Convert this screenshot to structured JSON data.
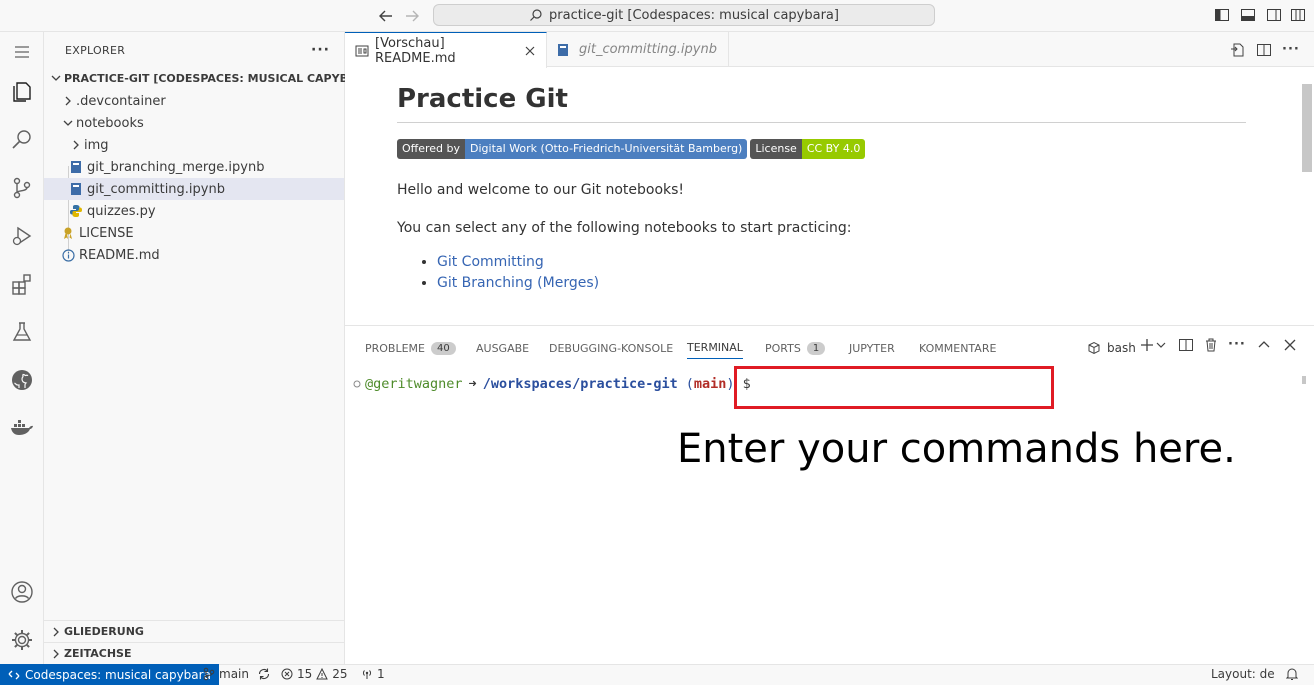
{
  "titlebar": {
    "search_text": "practice-git [Codespaces: musical capybara]"
  },
  "activity": {
    "items": [
      "explorer-icon",
      "search-icon",
      "source-control-icon",
      "run-debug-icon",
      "extensions-icon",
      "testing-icon",
      "github-icon",
      "docker-icon"
    ],
    "bottom": [
      "account-icon",
      "settings-gear-icon"
    ]
  },
  "sidebar": {
    "title": "EXPLORER",
    "root": "PRACTICE-GIT [CODESPACES: MUSICAL CAPYBARA]",
    "items": [
      {
        "label": ".devcontainer"
      },
      {
        "label": "notebooks"
      },
      {
        "label": "img"
      },
      {
        "label": "git_branching_merge.ipynb"
      },
      {
        "label": "git_committing.ipynb"
      },
      {
        "label": "quizzes.py"
      },
      {
        "label": "LICENSE"
      },
      {
        "label": "README.md"
      }
    ],
    "sections": [
      "GLIEDERUNG",
      "ZEITACHSE"
    ]
  },
  "tabs": [
    {
      "label": "[Vorschau] README.md",
      "active": true
    },
    {
      "label": "git_committing.ipynb",
      "active": false
    }
  ],
  "preview": {
    "title": "Practice Git",
    "badges": [
      {
        "left": "Offered by",
        "right": "Digital Work (Otto-Friedrich-Universität Bamberg)",
        "color": "#4c7fc0"
      },
      {
        "left": "License",
        "right": "CC BY 4.0",
        "color": "#97ca00"
      }
    ],
    "para1": "Hello and welcome to our Git notebooks!",
    "para2": "You can select any of the following notebooks to start practicing:",
    "links": [
      "Git Committing",
      "Git Branching (Merges)"
    ]
  },
  "panel": {
    "tabs": [
      {
        "label": "PROBLEME",
        "count": "40"
      },
      {
        "label": "AUSGABE"
      },
      {
        "label": "DEBUGGING-KONSOLE"
      },
      {
        "label": "TERMINAL",
        "active": true
      },
      {
        "label": "PORTS",
        "count": "1"
      },
      {
        "label": "JUPYTER"
      },
      {
        "label": "KOMMENTARE"
      }
    ],
    "shell": "bash",
    "prompt": {
      "user": "@geritwagner",
      "arrow": "➜",
      "path": "/workspaces/practice-git",
      "branch_open": "(",
      "branch": "main",
      "branch_close": ")",
      "dollar": "$"
    },
    "annotation": "Enter your commands here."
  },
  "status": {
    "remote": "Codespaces: musical capybara",
    "branch": "main",
    "errors": "15",
    "warnings": "25",
    "ports": "1",
    "layout": "Layout: de"
  },
  "colors": {
    "accent": "#005fb8",
    "prompt_green": "#4e8b2a",
    "path_blue": "#2b4f9e",
    "branch_red": "#b22d27",
    "annotation_box": "#e01b24"
  }
}
